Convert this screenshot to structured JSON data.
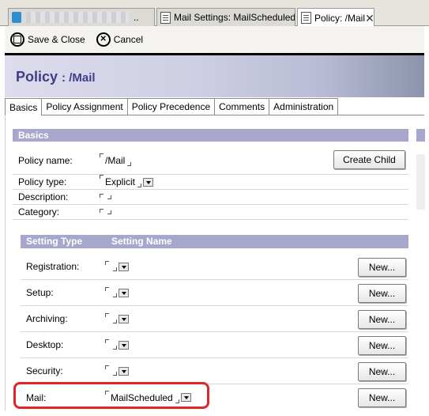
{
  "window_tabs": [
    {
      "label": "",
      "redacted": true
    },
    {
      "label": "Mail Settings: MailScheduled"
    },
    {
      "label": "Policy: /Mail",
      "active": true
    }
  ],
  "toolbar": {
    "save_close": "Save & Close",
    "cancel": "Cancel"
  },
  "banner": {
    "title": "Policy",
    "subtitle": ": /Mail"
  },
  "policy_tabs": [
    "Basics",
    "Policy Assignment",
    "Policy Precedence",
    "Comments",
    "Administration"
  ],
  "basics": {
    "header": "Basics",
    "fields": [
      {
        "label": "Policy name:",
        "value": "/Mail"
      },
      {
        "label": "Policy type:",
        "value": "Explicit"
      },
      {
        "label": "Description:",
        "value": ""
      },
      {
        "label": "Category:",
        "value": ""
      }
    ],
    "create_child": "Create Child"
  },
  "settings": {
    "col_type": "Setting Type",
    "col_name": "Setting Name",
    "rows": [
      {
        "label": "Registration:",
        "value": "",
        "button": "New..."
      },
      {
        "label": "Setup:",
        "value": "",
        "button": "New..."
      },
      {
        "label": "Archiving:",
        "value": "",
        "button": "New..."
      },
      {
        "label": "Desktop:",
        "value": "",
        "button": "New..."
      },
      {
        "label": "Security:",
        "value": "",
        "button": "New..."
      },
      {
        "label": "Mail:",
        "value": "MailScheduled",
        "button": "New..."
      }
    ]
  },
  "colors": {
    "section_header": "#a7a7cd",
    "banner_title": "#3d3d8a",
    "highlight": "#e0262b"
  }
}
